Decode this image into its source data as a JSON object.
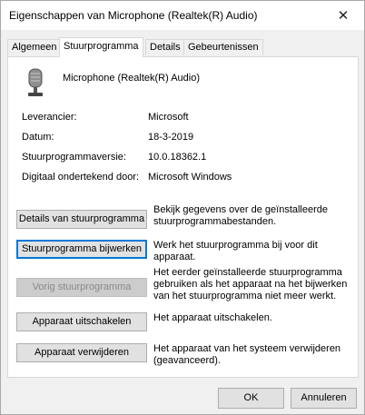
{
  "window": {
    "title": "Eigenschappen van Microphone (Realtek(R) Audio)",
    "close_glyph": "✕"
  },
  "tabs": [
    {
      "label": "Algemeen"
    },
    {
      "label": "Stuurprogramma",
      "active": true
    },
    {
      "label": "Details"
    },
    {
      "label": "Gebeurtenissen"
    }
  ],
  "device": {
    "name": "Microphone (Realtek(R) Audio)",
    "icon": "microphone-icon"
  },
  "info": [
    {
      "label": "Leverancier:",
      "value": "Microsoft"
    },
    {
      "label": "Datum:",
      "value": "18-3-2019"
    },
    {
      "label": "Stuurprogrammaversie:",
      "value": "10.0.18362.1"
    },
    {
      "label": "Digitaal ondertekend door:",
      "value": "Microsoft Windows"
    }
  ],
  "actions": [
    {
      "button": "Details van stuurprogramma",
      "desc": "Bekijk gegevens over de geïnstalleerde stuurprogrammabestanden."
    },
    {
      "button": "Stuurprogramma bijwerken",
      "desc": "Werk het stuurprogramma bij voor dit apparaat."
    },
    {
      "button": "Vorig stuurprogramma",
      "desc": "Het eerder geïnstalleerde stuurprogramma gebruiken als het apparaat na het bijwerken van het stuurprogramma niet meer werkt."
    },
    {
      "button": "Apparaat uitschakelen",
      "desc": "Het apparaat uitschakelen."
    },
    {
      "button": "Apparaat verwijderen",
      "desc": "Het apparaat van het systeem verwijderen (geavanceerd)."
    }
  ],
  "footer": {
    "ok": "OK",
    "cancel": "Annuleren"
  },
  "colors": {
    "focus": "#0078d7",
    "disabled_bg": "#cccccc",
    "panel_bg": "#ffffff"
  }
}
